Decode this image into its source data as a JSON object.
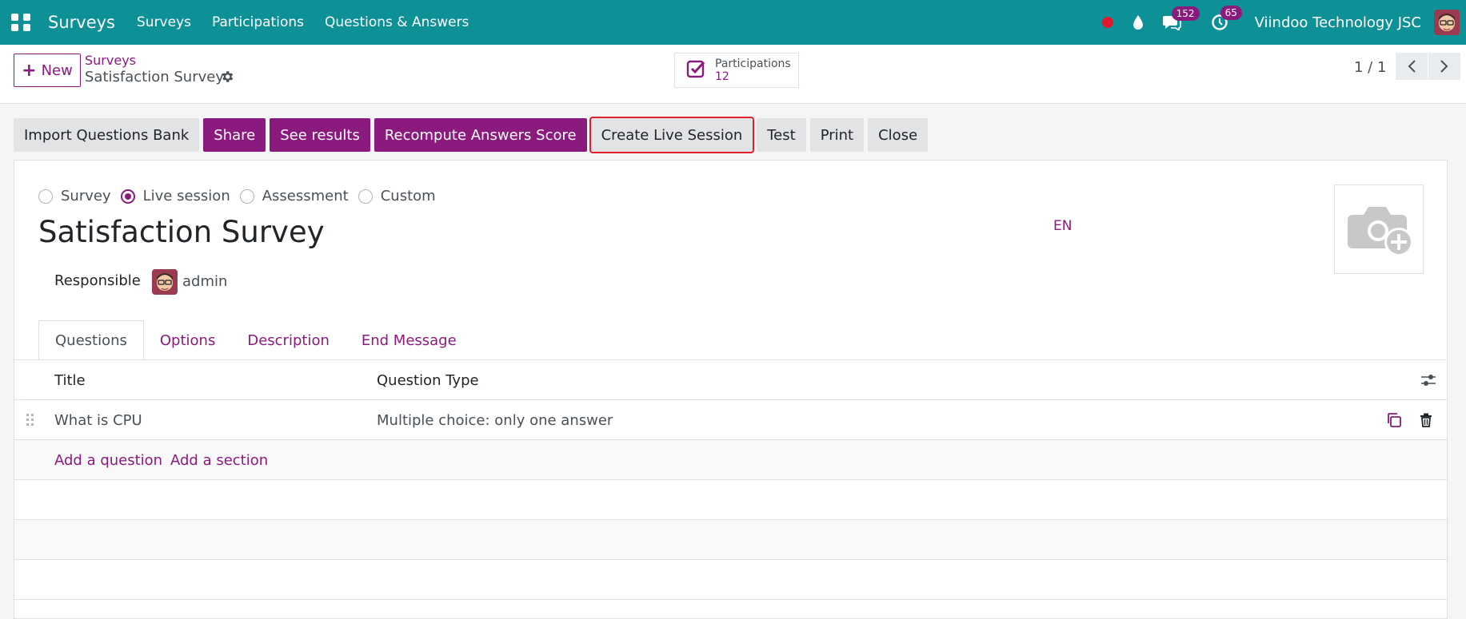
{
  "navbar": {
    "app_name": "Surveys",
    "menu": [
      "Surveys",
      "Participations",
      "Questions & Answers"
    ],
    "messages_count": "152",
    "activities_count": "65",
    "company": "Viindoo Technology JSC"
  },
  "control": {
    "new_label": "New",
    "breadcrumb_parent": "Surveys",
    "record_name": "Satisfaction Survey",
    "smart_button": {
      "label": "Participations",
      "value": "12"
    },
    "pager": "1 / 1"
  },
  "actions": {
    "import": "Import Questions Bank",
    "share": "Share",
    "see_results": "See results",
    "recompute": "Recompute Answers Score",
    "create_live": "Create Live Session",
    "test": "Test",
    "print": "Print",
    "close": "Close"
  },
  "form": {
    "survey_types": [
      "Survey",
      "Live session",
      "Assessment",
      "Custom"
    ],
    "selected_type": "Live session",
    "title": "Satisfaction Survey",
    "lang": "EN",
    "responsible_label": "Responsible",
    "responsible_name": "admin",
    "tabs": [
      "Questions",
      "Options",
      "Description",
      "End Message"
    ]
  },
  "questions_table": {
    "columns": [
      "Title",
      "Question Type"
    ],
    "rows": [
      {
        "title": "What is CPU",
        "type": "Multiple choice: only one answer"
      }
    ],
    "add_question": "Add a question",
    "add_section": "Add a section"
  },
  "colors": {
    "navbar": "#0e9196",
    "primary": "#8b1a7e",
    "highlight": "#e01f2a"
  }
}
